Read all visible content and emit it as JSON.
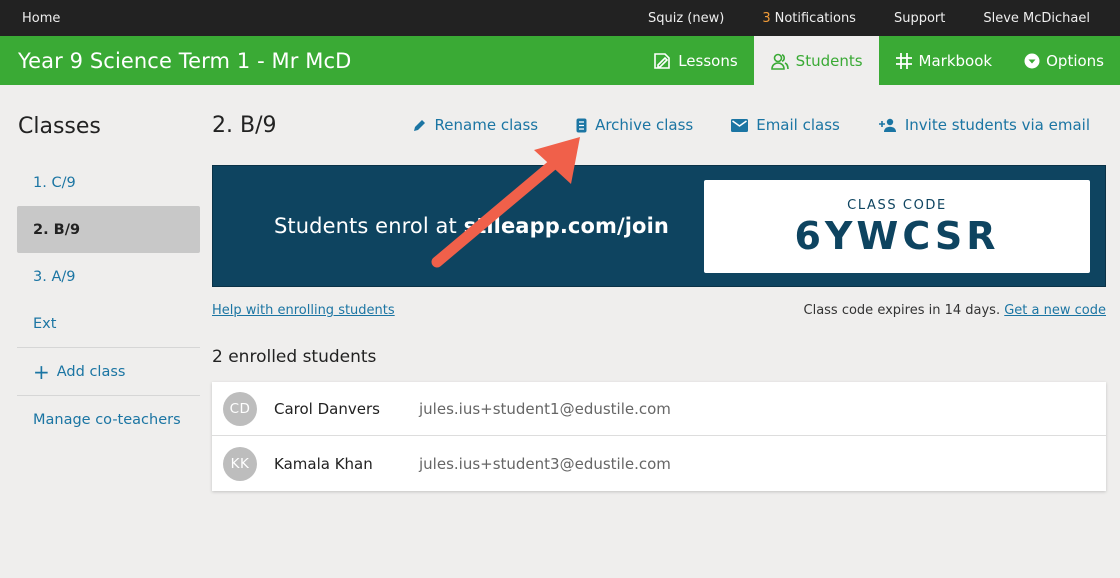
{
  "topbar": {
    "home": "Home",
    "squiz": "Squiz (new)",
    "notifications_count": "3",
    "notifications_label": "Notifications",
    "support": "Support",
    "user": "Sleve McDichael"
  },
  "header": {
    "title": "Year 9 Science Term 1 - Mr McD",
    "tabs": [
      {
        "label": "Lessons",
        "icon": "lessons-icon"
      },
      {
        "label": "Students",
        "icon": "students-icon"
      },
      {
        "label": "Markbook",
        "icon": "grid-icon"
      },
      {
        "label": "Options",
        "icon": "chevron-down-circle-icon"
      }
    ],
    "active_tab": "Students"
  },
  "sidebar": {
    "heading": "Classes",
    "items": [
      {
        "label": "1. C/9"
      },
      {
        "label": "2. B/9"
      },
      {
        "label": "3. A/9"
      },
      {
        "label": "Ext"
      }
    ],
    "active_item": "2. B/9",
    "add_class": "Add class",
    "manage": "Manage co-teachers"
  },
  "main": {
    "class_name": "2. B/9",
    "actions": {
      "rename": "Rename class",
      "archive": "Archive class",
      "email": "Email class",
      "invite": "Invite students via email"
    },
    "banner": {
      "enrol_prefix": "Students enrol at ",
      "enrol_url": "stileapp.com/join",
      "code_label": "CLASS CODE",
      "code": "6YWCSR"
    },
    "help_link": "Help with enrolling students",
    "expires_text": "Class code expires in 14 days.",
    "new_code_link": "Get a new code",
    "enrolled_count": "2 enrolled students",
    "students": [
      {
        "initials": "CD",
        "name": "Carol Danvers",
        "email": "jules.ius+student1@edustile.com"
      },
      {
        "initials": "KK",
        "name": "Kamala Khan",
        "email": "jules.ius+student3@edustile.com"
      }
    ]
  },
  "colors": {
    "brand_green": "#3aaa35",
    "banner_navy": "#0e4460",
    "link_blue": "#1b75a3",
    "arrow_red": "#f0604a",
    "notification_orange": "#f19b38"
  }
}
